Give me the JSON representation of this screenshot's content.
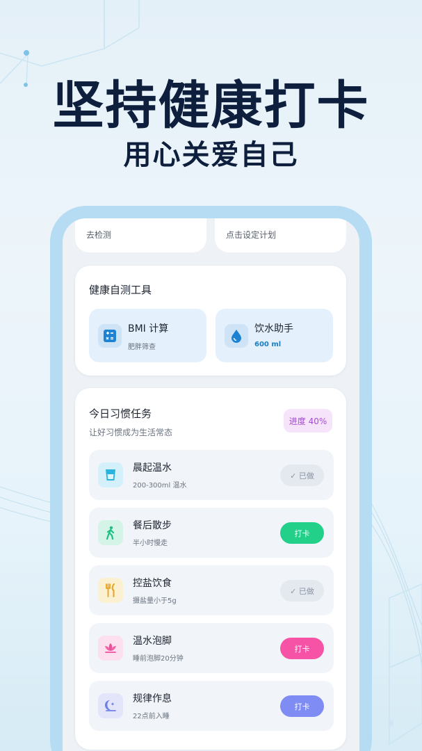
{
  "promo": {
    "headline": "坚持健康打卡",
    "subline": "用心关爱自己"
  },
  "top_cards": [
    {
      "label": "去检测"
    },
    {
      "label": "点击设定计划"
    }
  ],
  "tools": {
    "title": "健康自测工具",
    "items": [
      {
        "name": "BMI 计算",
        "sub": "肥胖筛查",
        "icon": "calculator-icon",
        "color": "#1e82d2"
      },
      {
        "name": "饮水助手",
        "sub": "600 ml",
        "icon": "water-drop-icon",
        "color": "#1e82d2"
      }
    ]
  },
  "habits": {
    "title": "今日习惯任务",
    "subtitle": "让好习惯成为生活常态",
    "progress_label": "进度 40%",
    "progress": 0.4,
    "items": [
      {
        "name": "晨起温水",
        "sub": "200-300ml 温水",
        "icon": "water-cup-icon",
        "icon_color": "#2bb3e0",
        "button": "✓ 已做",
        "done": true,
        "button_color": "#e4e9ef"
      },
      {
        "name": "餐后散步",
        "sub": "半小时慢走",
        "icon": "walking-person-icon",
        "icon_color": "#1fbf83",
        "button": "打卡",
        "done": false,
        "button_color": "#22d08a"
      },
      {
        "name": "控盐饮食",
        "sub": "摄盐量小于5g",
        "icon": "fork-knife-icon",
        "icon_color": "#e9a21c",
        "button": "✓ 已做",
        "done": true,
        "button_color": "#e4e9ef"
      },
      {
        "name": "温水泡脚",
        "sub": "睡前泡脚20分钟",
        "icon": "lotus-icon",
        "icon_color": "#ec4f9b",
        "button": "打卡",
        "done": false,
        "button_color": "#f653a6"
      },
      {
        "name": "规律作息",
        "sub": "22点前入睡",
        "icon": "moon-icon",
        "icon_color": "#6e7fe8",
        "button": "打卡",
        "done": false,
        "button_color": "#7f8cf3"
      }
    ]
  }
}
